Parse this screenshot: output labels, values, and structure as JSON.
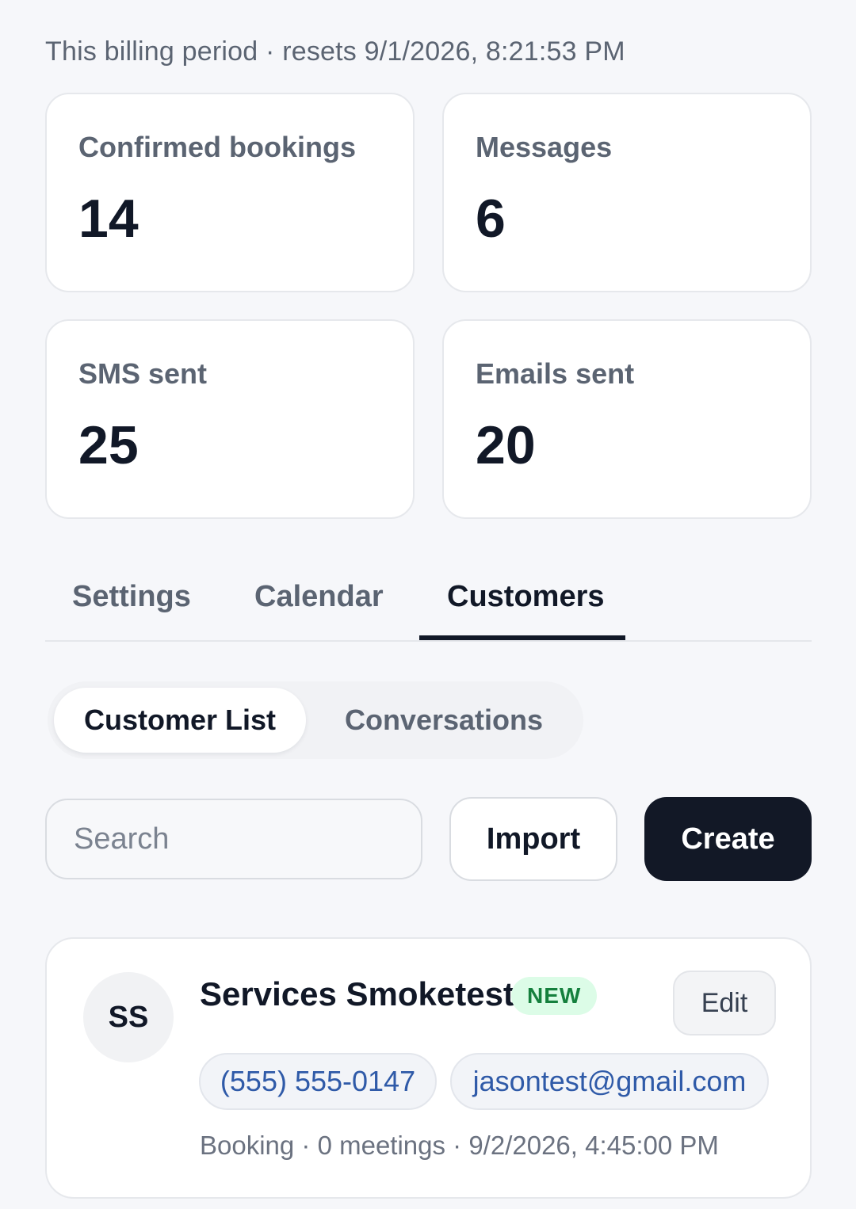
{
  "billing_period": {
    "text": "This billing period · resets 9/1/2026, 8:21:53 PM"
  },
  "stats": [
    {
      "label": "Confirmed bookings",
      "value": "14"
    },
    {
      "label": "Messages",
      "value": "6"
    },
    {
      "label": "SMS sent",
      "value": "25"
    },
    {
      "label": "Emails sent",
      "value": "20"
    }
  ],
  "tabs": [
    {
      "label": "Settings",
      "active": false
    },
    {
      "label": "Calendar",
      "active": false
    },
    {
      "label": "Customers",
      "active": true
    }
  ],
  "subtabs": [
    {
      "label": "Customer List",
      "active": true
    },
    {
      "label": "Conversations",
      "active": false
    }
  ],
  "toolbar": {
    "search_placeholder": "Search",
    "search_value": "",
    "import_label": "Import",
    "create_label": "Create"
  },
  "customers": [
    {
      "initials": "SS",
      "name": "Services Smoketest",
      "badge": "NEW",
      "edit_label": "Edit",
      "phone": "(555) 555-0147",
      "email": "jasontest@gmail.com",
      "meta": "Booking · 0 meetings · 9/2/2026, 4:45:00 PM"
    }
  ],
  "colors": {
    "background": "#f6f7fa",
    "primary_button": "#121826",
    "link_blue": "#2f5aa8",
    "badge_green_bg": "#dcfce7",
    "badge_green_text": "#15803d"
  }
}
